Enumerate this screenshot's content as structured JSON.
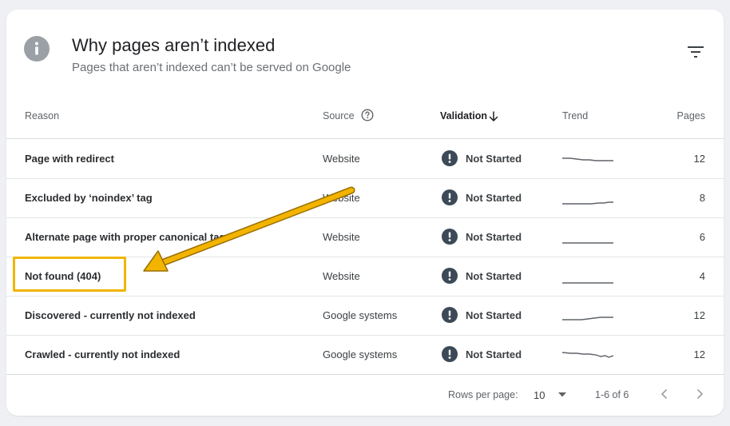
{
  "header": {
    "title": "Why pages aren’t indexed",
    "subtitle": "Pages that aren’t indexed can’t be served on Google",
    "info_icon": "info-icon",
    "filter_icon": "filter-icon"
  },
  "table": {
    "columns": {
      "reason": "Reason",
      "source": "Source",
      "validation": "Validation",
      "trend": "Trend",
      "pages": "Pages"
    },
    "rows": [
      {
        "reason": "Page with redirect",
        "source": "Website",
        "validation": "Not Started",
        "trend": "slightly-decreasing",
        "pages": "12"
      },
      {
        "reason": "Excluded by ‘noindex’ tag",
        "source": "Website",
        "validation": "Not Started",
        "trend": "slightly-increasing",
        "pages": "8"
      },
      {
        "reason": "Alternate page with proper canonical tag",
        "source": "Website",
        "validation": "Not Started",
        "trend": "flat",
        "pages": "6"
      },
      {
        "reason": "Not found (404)",
        "source": "Website",
        "validation": "Not Started",
        "trend": "flat",
        "pages": "4"
      },
      {
        "reason": "Discovered - currently not indexed",
        "source": "Google systems",
        "validation": "Not Started",
        "trend": "increasing",
        "pages": "12"
      },
      {
        "reason": "Crawled - currently not indexed",
        "source": "Google systems",
        "validation": "Not Started",
        "trend": "decreasing",
        "pages": "12"
      }
    ]
  },
  "footer": {
    "rows_per_page_label": "Rows per page:",
    "rows_per_page_value": "10",
    "range": "1-6 of 6"
  },
  "colors": {
    "status_icon": "#3c4a57",
    "highlight": "#f1b500",
    "trend_line": "#5f6368"
  }
}
